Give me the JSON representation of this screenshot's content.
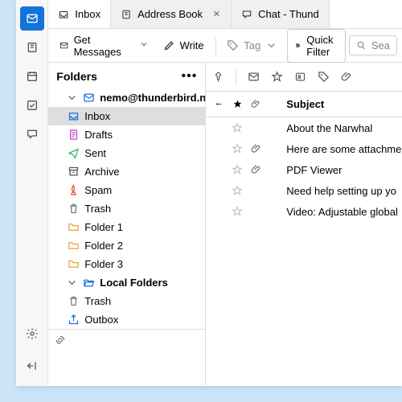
{
  "tabs": [
    {
      "label": "Inbox",
      "active": true
    },
    {
      "label": "Address Book",
      "active": false
    },
    {
      "label": "Chat - Thund",
      "active": false
    }
  ],
  "toolbar": {
    "get_messages": "Get Messages",
    "write": "Write",
    "tag": "Tag",
    "quick_filter": "Quick Filter",
    "search_placeholder": "Sea"
  },
  "folder_pane": {
    "title": "Folders",
    "accounts": [
      {
        "name": "nemo@thunderbird.net",
        "folders": [
          {
            "name": "Inbox",
            "icon": "inbox",
            "color": "#1373d9",
            "selected": true
          },
          {
            "name": "Drafts",
            "icon": "draft",
            "color": "#c23cc2"
          },
          {
            "name": "Sent",
            "icon": "sent",
            "color": "#2fb36f"
          },
          {
            "name": "Archive",
            "icon": "archive",
            "color": "#555"
          },
          {
            "name": "Spam",
            "icon": "spam",
            "color": "#e0452c"
          },
          {
            "name": "Trash",
            "icon": "trash",
            "color": "#777"
          },
          {
            "name": "Folder 1",
            "icon": "folder",
            "color": "#e8a33d"
          },
          {
            "name": "Folder 2",
            "icon": "folder",
            "color": "#e8a33d"
          },
          {
            "name": "Folder 3",
            "icon": "folder",
            "color": "#e8a33d"
          }
        ]
      },
      {
        "name": "Local Folders",
        "folders": [
          {
            "name": "Trash",
            "icon": "trash",
            "color": "#777"
          },
          {
            "name": "Outbox",
            "icon": "outbox",
            "color": "#1373d9"
          }
        ]
      }
    ]
  },
  "messages": {
    "header_subject": "Subject",
    "rows": [
      {
        "subject": "About the Narwhal",
        "attachment": false
      },
      {
        "subject": "Here are some attachme",
        "attachment": true
      },
      {
        "subject": "PDF Viewer",
        "attachment": true
      },
      {
        "subject": "Need help setting up yo",
        "attachment": false
      },
      {
        "subject": "Video: Adjustable global",
        "attachment": false
      }
    ]
  }
}
